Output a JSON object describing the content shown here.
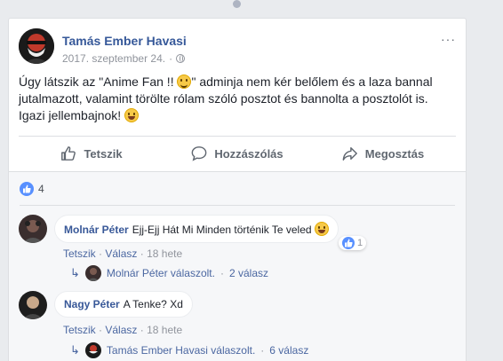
{
  "post": {
    "author": "Tamás Ember Havasi",
    "date": "2017. szeptember 24.",
    "more_label": "···",
    "text_part1": "Úgy látszik az \"Anime Fan !! ",
    "text_part2": "\" adminja nem kér belőlem és a laza bannal jutalmazott, valamint törölte rólam szóló posztot és bannolta a posztolót is. Igazi jellembajnok! ",
    "actions": {
      "like": "Tetszik",
      "comment": "Hozzászólás",
      "share": "Megosztás"
    },
    "reactions_count": "4"
  },
  "comments": [
    {
      "author": "Molnár Péter",
      "text": "Ejj-Ejj Hát Mi Minden történik Te veled ",
      "like": "Tetszik",
      "reply": "Válasz",
      "time": "18 hete",
      "like_count": "1",
      "reply_author": "Molnár Péter válaszolt.",
      "reply_count": "2 válasz"
    },
    {
      "author": "Nagy Péter",
      "text": "A Tenke? Xd",
      "like": "Tetszik",
      "reply": "Válasz",
      "time": "18 hete",
      "reply_author": "Tamás Ember Havasi válaszolt.",
      "reply_count": "6 válasz"
    }
  ],
  "colors": {
    "link": "#365899",
    "like_blue": "#5890ff",
    "meta": "#90949c"
  }
}
